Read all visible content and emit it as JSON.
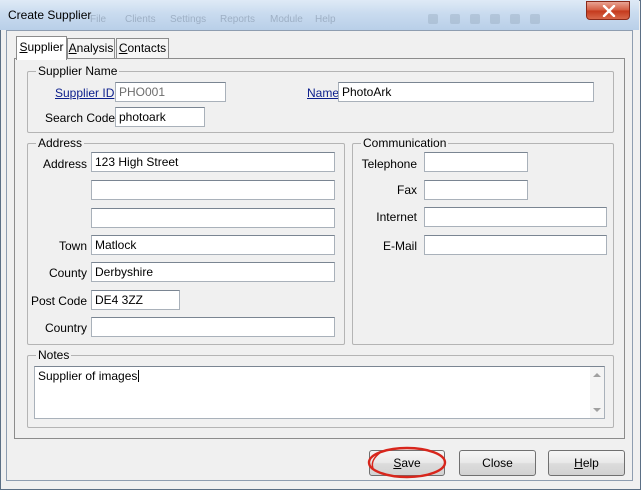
{
  "window": {
    "title": "Create Supplier",
    "ghost_menu": [
      "File",
      "Clients",
      "Settings",
      "Reports",
      "Module",
      "Help"
    ],
    "close_icon": "close-icon"
  },
  "tabs": [
    {
      "label": "Supplier",
      "accel": "S",
      "rest": "upplier",
      "active": true
    },
    {
      "label": "Analysis",
      "accel": "A",
      "rest": "nalysis",
      "active": false
    },
    {
      "label": "Contacts",
      "accel": "C",
      "rest": "ontacts",
      "active": false
    }
  ],
  "supplier_name": {
    "group_title": "Supplier Name",
    "supplier_id_label": "Supplier ID",
    "supplier_id_value": "PHO001",
    "name_label": "Name",
    "name_value": "PhotoArk",
    "search_code_label": "Search Code",
    "search_code_value": "photoark"
  },
  "address": {
    "group_title": "Address",
    "address_label": "Address",
    "line1": "123 High Street",
    "line2": "",
    "line3": "",
    "town_label": "Town",
    "town": "Matlock",
    "county_label": "County",
    "county": "Derbyshire",
    "postcode_label": "Post Code",
    "postcode": "DE4 3ZZ",
    "country_label": "Country",
    "country": ""
  },
  "communication": {
    "group_title": "Communication",
    "telephone_label": "Telephone",
    "telephone": "",
    "fax_label": "Fax",
    "fax": "",
    "internet_label": "Internet",
    "internet": "",
    "email_label": "E-Mail",
    "email": ""
  },
  "notes": {
    "group_title": "Notes",
    "text": "Supplier of images"
  },
  "buttons": {
    "save": {
      "accel": "S",
      "rest": "ave"
    },
    "close": "Close",
    "help": {
      "accel": "H",
      "rest": "elp"
    }
  },
  "colors": {
    "link": "#0b1e8c",
    "annotation_ring": "#d8261c"
  }
}
